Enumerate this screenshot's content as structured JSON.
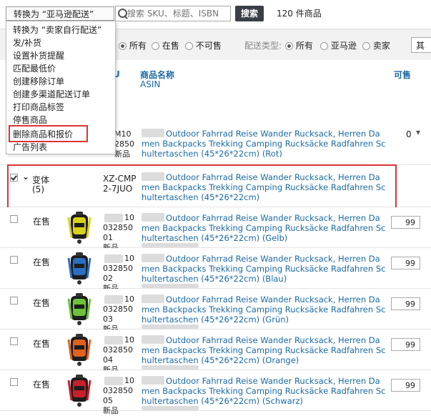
{
  "toolbar": {
    "action_selected": "转换为 “亚马逊配送”",
    "search_placeholder": "搜索 SKU、标题、ISBN",
    "search_button": "搜索",
    "product_count": "120 件商品"
  },
  "action_menu": [
    "转换为 “卖家自行配送”",
    "发/补货",
    "设置补货提醒",
    "匹配最低价",
    "创建移除订单",
    "创建多渠道配送订单",
    "打印商品标签",
    "停售商品",
    "删除商品和报价",
    "广告列表"
  ],
  "filters": {
    "status_options": [
      "所有",
      "在售",
      "不可售"
    ],
    "status_selected": "所有",
    "fulfillment_label": "配送类型:",
    "fulfillment_options": [
      "所有",
      "亚马逊",
      "卖家"
    ],
    "fulfillment_selected": "所有",
    "more_label": "其"
  },
  "columns": {
    "sku_short": "U",
    "name": "商品名称",
    "asin": "ASIN",
    "available": "可售"
  },
  "rows": [
    {
      "sku_lines": [
        "M10",
        "2850",
        "新品"
      ],
      "title_lines": [
        "Outdoor Fahrrad Reise Wander Rucksack, Herren Da",
        "men Backpacks Trekking Camping Rucksäcke Radfahren Sc",
        "hultertaschen (45*26*22cm) (Rot)"
      ],
      "available": "0"
    },
    {
      "status": "变体",
      "variant_count": "(5)",
      "sku_lines": [
        "XZ-CMP",
        "2-7JUO"
      ],
      "title_lines": [
        "Outdoor Fahrrad Reise Wander Rucksack, Herren Da",
        "men Backpacks Trekking Camping Rucksäcke Radfahren Sc",
        "hultertaschen (45*26*22cm)"
      ]
    },
    {
      "status": "在售",
      "sku_lines": [
        "10",
        "032850",
        "01",
        "新品"
      ],
      "title_lines": [
        "Outdoor Fahrrad Reise Wander Rucksack, Herren Da",
        "men Backpacks Trekking Camping Rucksäcke Radfahren Sc",
        "hultertaschen (45*26*22cm) (Gelb)"
      ],
      "qty": "99"
    },
    {
      "status": "在售",
      "sku_lines": [
        "10",
        "032850",
        "02",
        "新品"
      ],
      "title_lines": [
        "Outdoor Fahrrad Reise Wander Rucksack, Herren Da",
        "men Backpacks Trekking Camping Rucksäcke Radfahren Sc",
        "hultertaschen (45*26*22cm) (Blau)"
      ],
      "qty": "99"
    },
    {
      "status": "在售",
      "sku_lines": [
        "10",
        "032850",
        "03",
        "新品"
      ],
      "title_lines": [
        "Outdoor Fahrrad Reise Wander Rucksack, Herren Da",
        "men Backpacks Trekking Camping Rucksäcke Radfahren Sc",
        "hultertaschen (45*26*22cm) (Grün)"
      ],
      "qty": "99"
    },
    {
      "status": "在售",
      "sku_lines": [
        "10",
        "032850",
        "04",
        "新品"
      ],
      "title_lines": [
        "Outdoor Fahrrad Reise Wander Rucksack, Herren Da",
        "men Backpacks Trekking Camping Rucksäcke Radfahren Sc",
        "hultertaschen (45*26*22cm) (Orange)"
      ],
      "qty": "99"
    },
    {
      "status": "在售",
      "sku_lines": [
        "10",
        "032850",
        "05",
        "新品"
      ],
      "title_lines": [
        "Outdoor Fahrrad Reise Wander Rucksack, Herren Da",
        "men Backpacks Trekking Camping Rucksäcke Radfahren Sc",
        "hultertaschen (45*26*22cm) (Schwarz)"
      ],
      "qty": "99"
    }
  ],
  "colors": {
    "link": "#1a6aa8",
    "highlight": "#d33333",
    "backpack_yellow": "#d8d21a",
    "backpack_blue": "#2b6fc4",
    "backpack_green": "#6ec23a",
    "backpack_orange": "#e2601e",
    "backpack_red": "#c8202a"
  }
}
